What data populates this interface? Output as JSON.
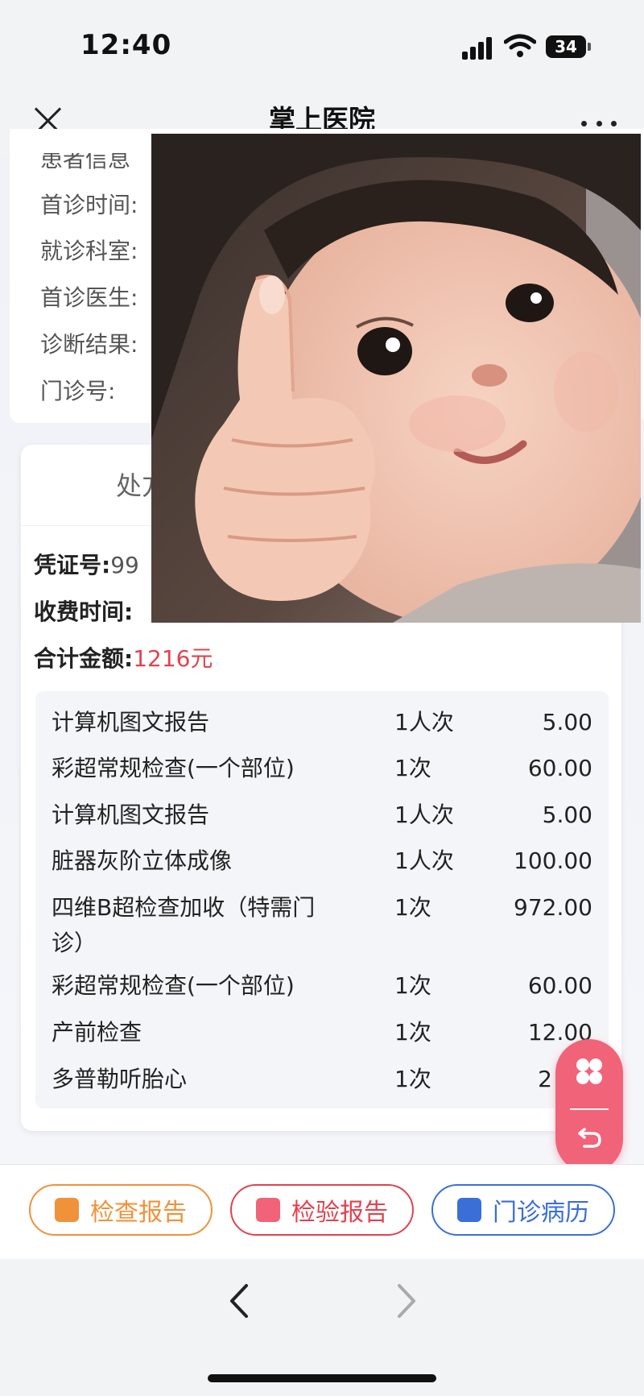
{
  "status_bar": {
    "time": "12:40",
    "battery": "34"
  },
  "nav": {
    "title": "掌上医院"
  },
  "patient_info": {
    "rows": [
      {
        "label": "患者信息"
      },
      {
        "label": "首诊时间:"
      },
      {
        "label": "就诊科室:"
      },
      {
        "label": "首诊医生:"
      },
      {
        "label": "诊断结果:"
      },
      {
        "label": "门诊号:"
      }
    ]
  },
  "prescription": {
    "title": "处方",
    "voucher_label": "凭证号:",
    "voucher_value": "99",
    "charge_time_label": "收费时间:",
    "total_label": "合计金额:",
    "total_value": "1216元",
    "items": [
      {
        "name": "计算机图文报告",
        "qty": "1人次",
        "price": "5.00"
      },
      {
        "name": "彩超常规检查(一个部位)",
        "qty": "1次",
        "price": "60.00"
      },
      {
        "name": "计算机图文报告",
        "qty": "1人次",
        "price": "5.00"
      },
      {
        "name": "脏器灰阶立体成像",
        "qty": "1人次",
        "price": "100.00"
      },
      {
        "name": "四维B超检查加收（特需门诊）",
        "qty": "1次",
        "price": "972.00"
      },
      {
        "name": "彩超常规检查(一个部位)",
        "qty": "1次",
        "price": "60.00"
      },
      {
        "name": "产前检查",
        "qty": "1次",
        "price": "12.00"
      },
      {
        "name": "多普勒听胎心",
        "qty": "1次",
        "price": "2"
      }
    ]
  },
  "bottom_actions": [
    {
      "label": "检查报告",
      "color": "#f0923a"
    },
    {
      "label": "检验报告",
      "color": "#e0434f"
    },
    {
      "label": "门诊病历",
      "color": "#3a6fd8"
    }
  ],
  "overlay_image": {
    "subject": "child giving thumbs up"
  }
}
